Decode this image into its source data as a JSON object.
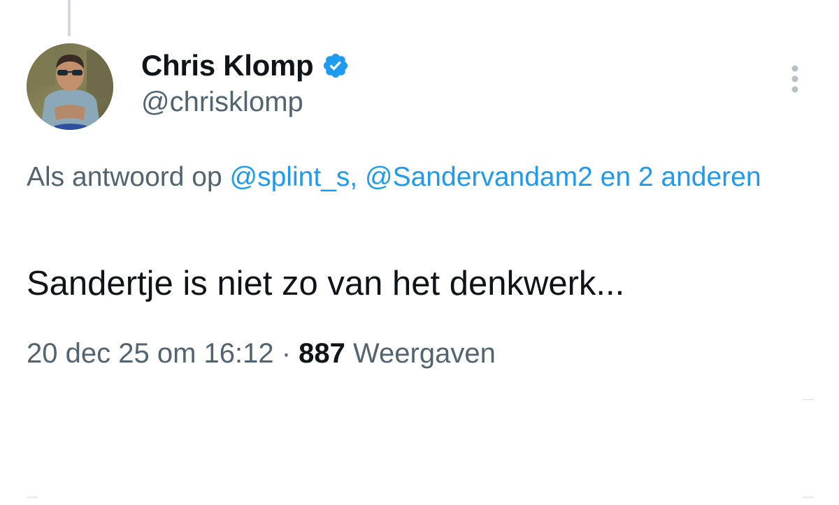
{
  "author": {
    "display_name": "Chris Klomp",
    "handle": "@chrisklomp",
    "verified": true,
    "verified_color": "#1d9bf0"
  },
  "reply_context": {
    "prefix": "Als antwoord op ",
    "mention_1": "@splint_s",
    "separator": ", ",
    "mention_2": "@Sandervandam2",
    "connector": " en ",
    "others": "2 anderen"
  },
  "tweet": {
    "text": "Sandertje is niet zo van het denkwerk..."
  },
  "meta": {
    "timestamp": "20 dec 25 om 16:12",
    "dot": " · ",
    "views_count": "887",
    "views_label": " Weergaven"
  },
  "icons": {
    "verified": "verified-badge-icon",
    "more": "more-options-icon"
  },
  "colors": {
    "link": "#1d9bf0",
    "secondary_text": "#536471",
    "primary_text": "#0f1419"
  }
}
